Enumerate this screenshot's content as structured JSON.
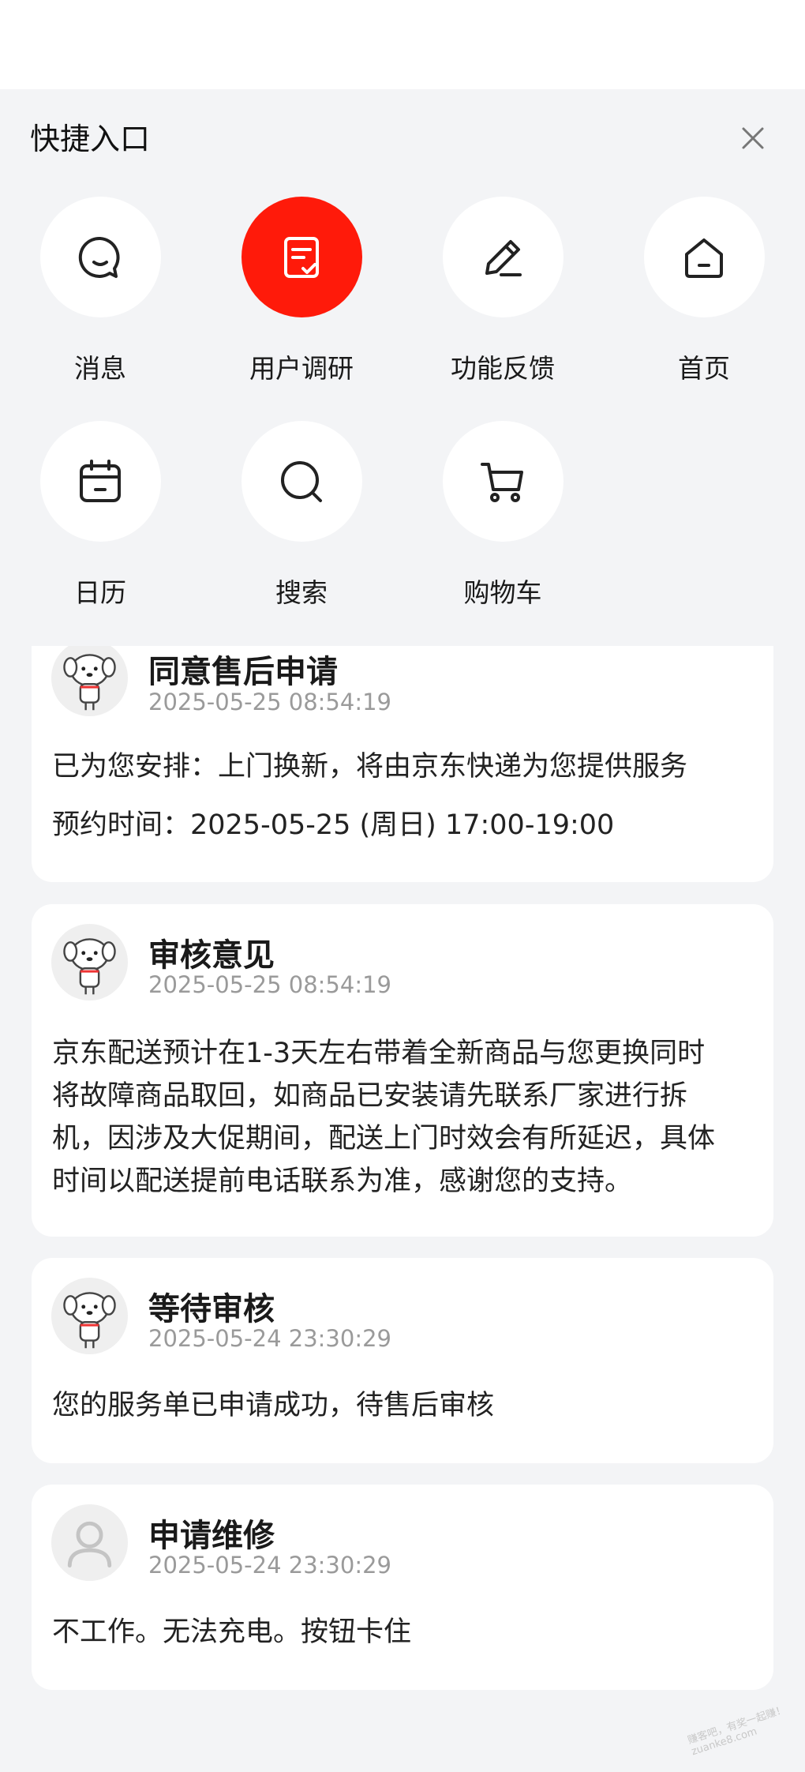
{
  "quick_entry": {
    "title": "快捷入口",
    "items": [
      {
        "label": "消息",
        "icon": "message-bubble-icon"
      },
      {
        "label": "用户调研",
        "icon": "survey-icon",
        "active": true
      },
      {
        "label": "功能反馈",
        "icon": "pencil-icon"
      },
      {
        "label": "首页",
        "icon": "home-icon"
      },
      {
        "label": "日历",
        "icon": "calendar-icon"
      },
      {
        "label": "搜索",
        "icon": "search-icon"
      },
      {
        "label": "购物车",
        "icon": "cart-icon"
      }
    ]
  },
  "records": [
    {
      "title": "同意售后申请",
      "time": "2025-05-25 08:54:19",
      "lines": [
        "已为您安排：上门换新，将由京东快递为您提供服务",
        "预约时间：2025-05-25 (周日) 17:00-19:00"
      ],
      "avatar": "jd-mascot-icon"
    },
    {
      "title": "审核意见",
      "time": "2025-05-25 08:54:19",
      "lines": [
        "京东配送预计在1-3天左右带着全新商品与您更换同时",
        "将故障商品取回，如商品已安装请先联系厂家进行拆",
        "机，因涉及大促期间，配送上门时效会有所延迟，具体",
        "时间以配送提前电话联系为准，感谢您的支持。"
      ],
      "avatar": "jd-mascot-icon"
    },
    {
      "title": "等待审核",
      "time": "2025-05-24 23:30:29",
      "lines": [
        "您的服务单已申请成功，待售后审核"
      ],
      "avatar": "jd-mascot-icon"
    },
    {
      "title": "申请维修",
      "time": "2025-05-24 23:30:29",
      "lines": [
        "不工作。无法充电。按钮卡住"
      ],
      "avatar": "user-avatar-icon"
    }
  ],
  "watermark": "赚客吧，有奖一起赚！ zuanke8.com",
  "colors": {
    "accent": "#ff1a0a",
    "background": "#f3f4f6",
    "card": "#ffffff",
    "muted_text": "#9a9a9a"
  }
}
